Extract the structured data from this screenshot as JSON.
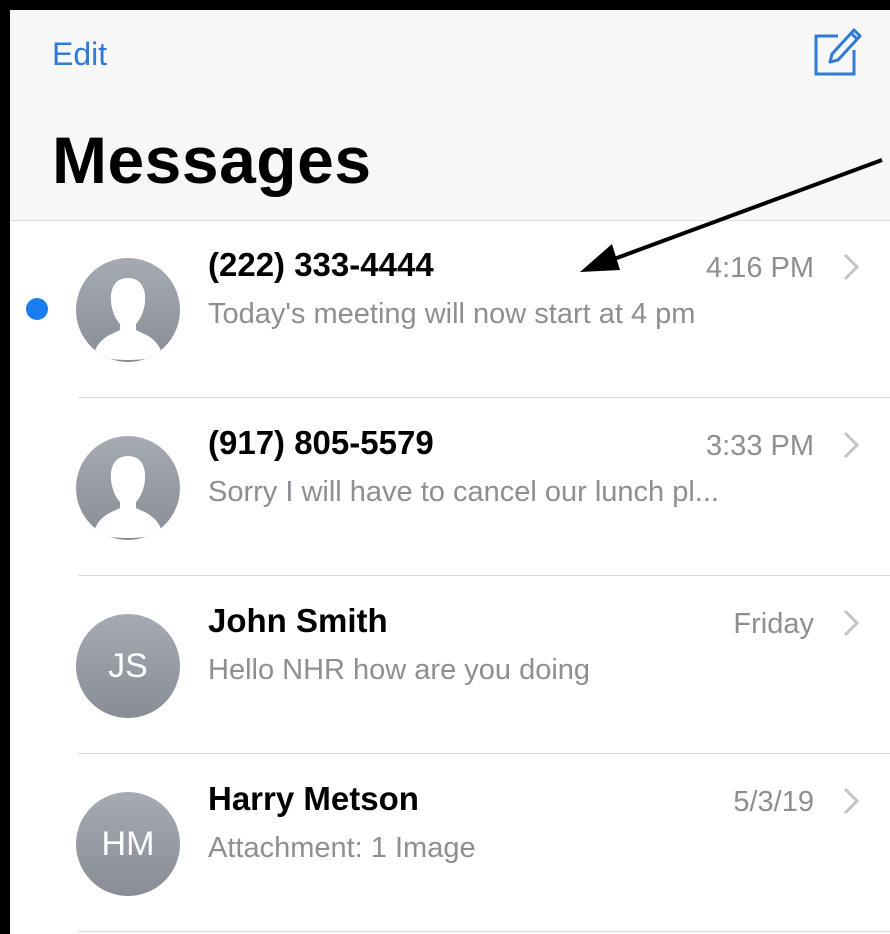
{
  "header": {
    "edit_label": "Edit",
    "compose_icon": "compose-icon",
    "title": "Messages"
  },
  "conversations": [
    {
      "name": "(222) 333-4444",
      "time": "4:16 PM",
      "preview": "Today's meeting will now start at 4 pm",
      "unread": true,
      "avatar": "person-icon"
    },
    {
      "name": "(917) 805-5579",
      "time": "3:33 PM",
      "preview": "Sorry I will have to cancel our lunch pl...",
      "unread": false,
      "avatar": "person-icon"
    },
    {
      "name": "John Smith",
      "time": "Friday",
      "preview": "Hello NHR how are you doing",
      "unread": false,
      "initials": "JS"
    },
    {
      "name": "Harry Metson",
      "time": "5/3/19",
      "preview": "Attachment: 1 Image",
      "unread": false,
      "initials": "HM"
    }
  ],
  "colors": {
    "accent": "#2f7bd6",
    "unread_dot": "#1a7df1",
    "secondary_text": "#8e8e93"
  }
}
